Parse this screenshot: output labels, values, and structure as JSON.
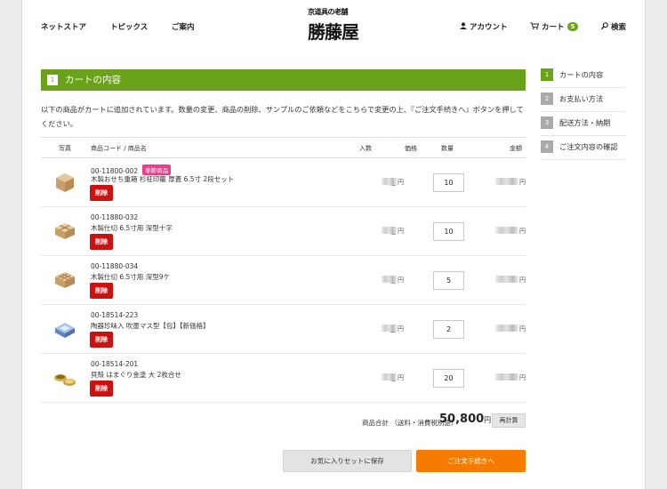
{
  "header": {
    "nav_left": [
      "ネットストア",
      "トピックス",
      "ご案内"
    ],
    "logo_small": "京道具の老舗",
    "logo_main": "勝藤屋",
    "account": "アカウント",
    "cart": "カート",
    "cart_count": "5",
    "search": "検索"
  },
  "cart": {
    "step_number": "1",
    "title": "カートの内容",
    "intro": "以下の商品がカートに追加されています。数量の変更、商品の削除、サンプルのご依頼などをこちらで変更の上、『ご注文手続きへ』ボタンを押してください。",
    "columns": {
      "photo": "写真",
      "code_name": "商品コード / 商品名",
      "iri": "入数",
      "price": "価格",
      "qty": "数量",
      "amount": "金額"
    },
    "items": [
      {
        "code": "00-11800-002",
        "badge": "季節商品",
        "name": "木製おせち重箱 杉柾印籠 厚蓋 6.5寸 2段セット",
        "iri": "1組",
        "qty": "10",
        "delete": "削除",
        "thumb": "box"
      },
      {
        "code": "00-11880-032",
        "badge": "",
        "name": "木製仕切 6.5寸用 深型十字",
        "iri": "1組",
        "qty": "10",
        "delete": "削除",
        "thumb": "grid4"
      },
      {
        "code": "00-11880-034",
        "badge": "",
        "name": "木製仕切 6.5寸用 深型9ケ",
        "iri": "1組",
        "qty": "5",
        "delete": "削除",
        "thumb": "grid9"
      },
      {
        "code": "00-18514-223",
        "badge": "",
        "name": "陶器珍味入 吹墨マス型【包】【新価格】",
        "iri": "10個",
        "qty": "2",
        "delete": "削除",
        "thumb": "blue"
      },
      {
        "code": "00-18514-201",
        "badge": "",
        "name": "貝殻 はまぐり金塗 大 2枚合せ",
        "iri": "1組",
        "qty": "20",
        "delete": "削除",
        "thumb": "gold"
      }
    ],
    "yen": "円",
    "total_label": "商品合計 （送料・消費税別途）",
    "total_value": "50,800",
    "total_unit": "円",
    "recalc": "再計算",
    "fav_button": "お気に入りセットに保存",
    "order_button": "ご注文手続きへ"
  },
  "steps": [
    {
      "num": "1",
      "label": "カートの内容",
      "active": true
    },
    {
      "num": "2",
      "label": "お支払い方法",
      "active": false
    },
    {
      "num": "3",
      "label": "配送方法・納期",
      "active": false
    },
    {
      "num": "4",
      "label": "ご注文内容の確認",
      "active": false
    }
  ]
}
